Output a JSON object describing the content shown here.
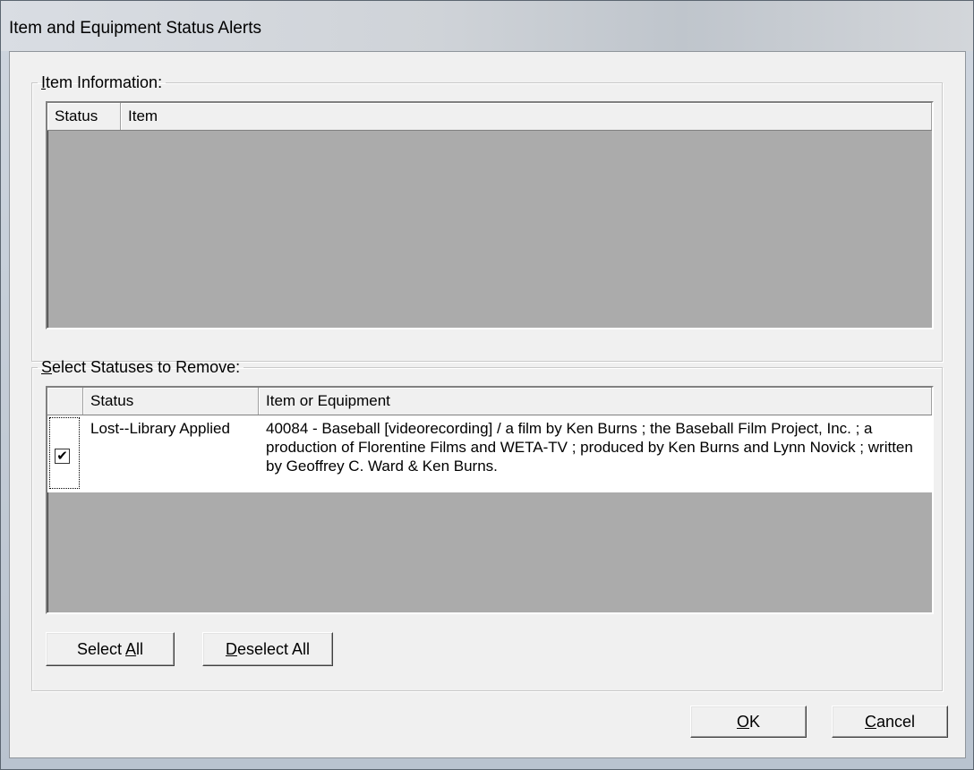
{
  "window": {
    "title": "Item and Equipment Status Alerts"
  },
  "item_info": {
    "legend_prefix": "",
    "legend_key": "I",
    "legend_rest": "tem Information:",
    "columns": [
      "Status",
      "Item"
    ]
  },
  "select_statuses": {
    "legend_key": "S",
    "legend_rest": "elect Statuses to Remove:",
    "columns": [
      "",
      "Status",
      "Item or Equipment"
    ],
    "rows": [
      {
        "checked": true,
        "check_glyph": "✔",
        "status": "Lost--Library Applied",
        "item": "40084 - Baseball [videorecording] / a film by Ken Burns ; the Baseball Film Project, Inc. ; a production of Florentine Films and WETA-TV ; produced by Ken Burns and Lynn Novick ; written by Geoffrey C. Ward & Ken Burns."
      }
    ]
  },
  "buttons": {
    "select_all_pre": "Select ",
    "select_all_key": "A",
    "select_all_post": "ll",
    "deselect_all_key": "D",
    "deselect_all_post": "eselect All",
    "ok_key": "O",
    "ok_post": "K",
    "cancel_key": "C",
    "cancel_post": "ancel"
  }
}
